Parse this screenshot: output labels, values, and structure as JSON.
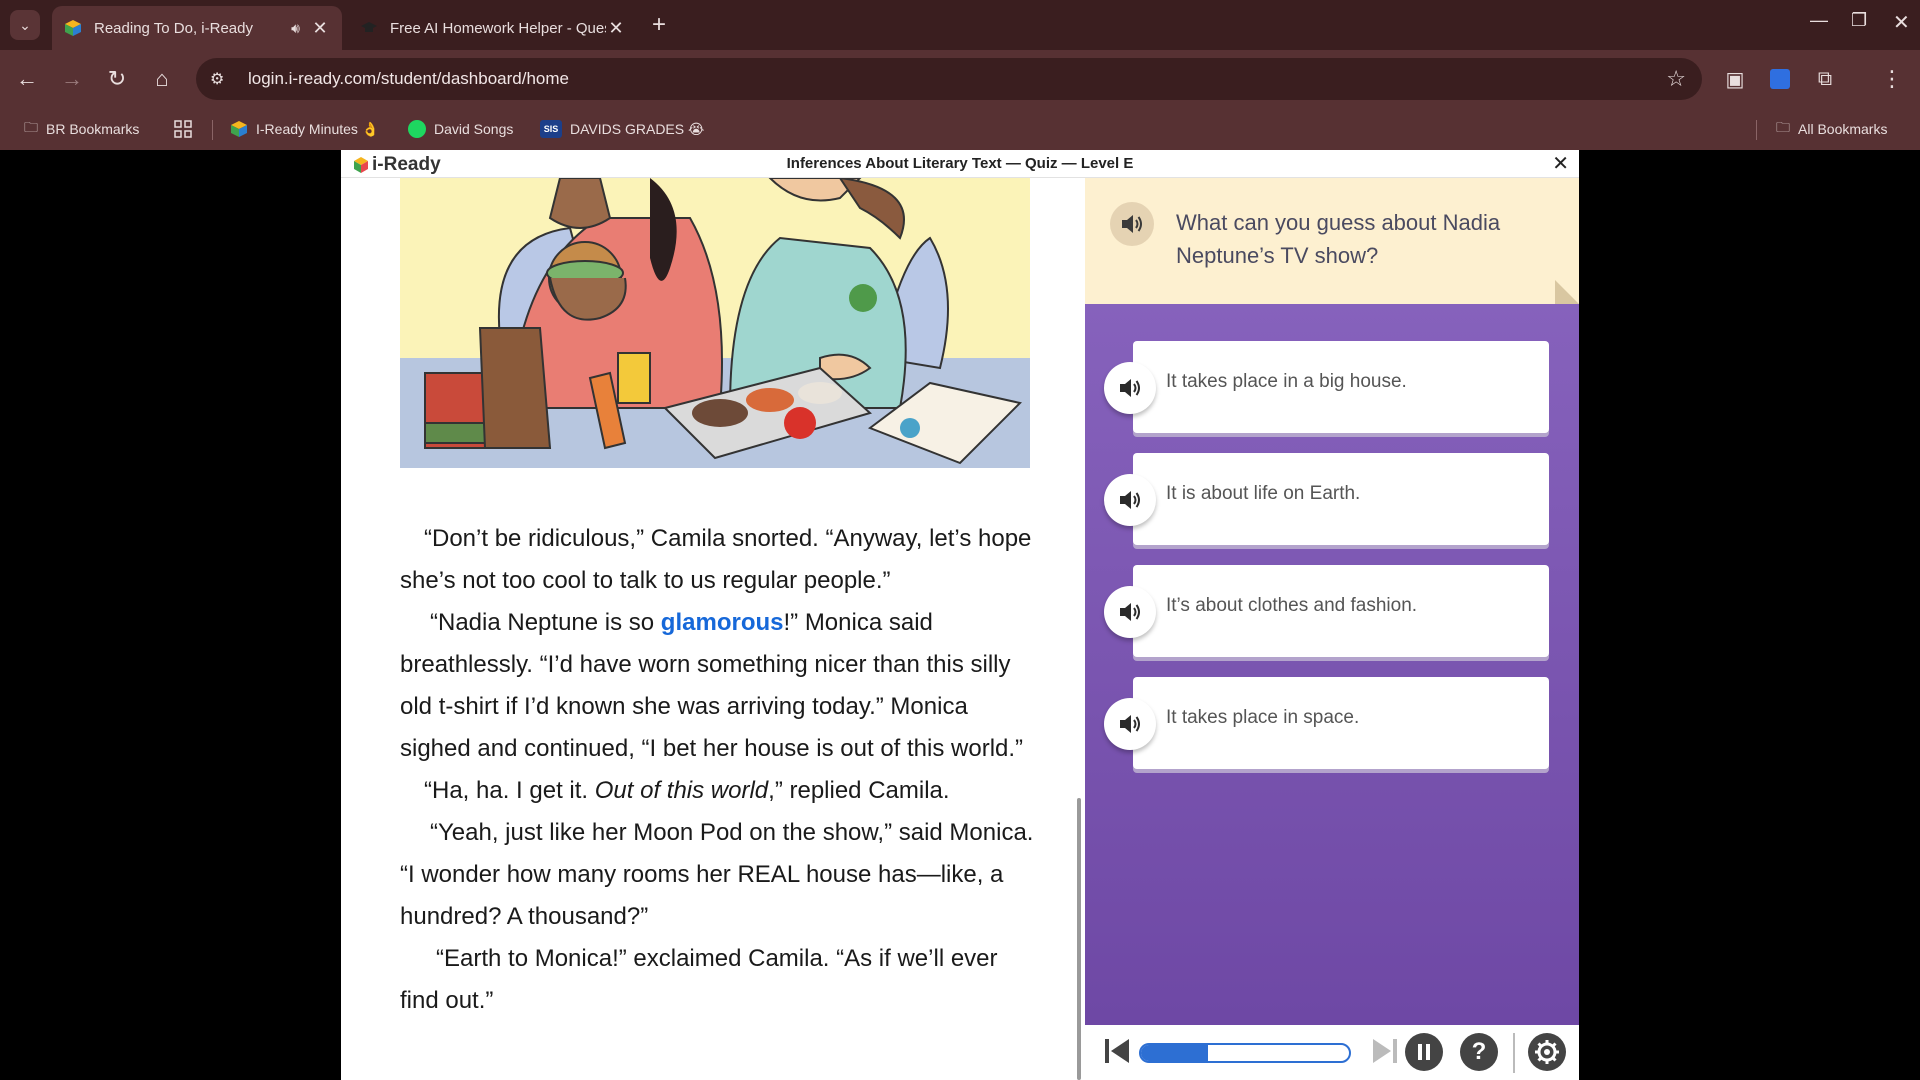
{
  "browser": {
    "tabs": [
      {
        "title": "Reading To Do, i-Ready",
        "active": true,
        "audio": true
      },
      {
        "title": "Free AI Homework Helper - Quest",
        "active": false,
        "audio": false
      }
    ],
    "url": "login.i-ready.com/student/dashboard/home",
    "bookmarks": [
      {
        "label": "BR Bookmarks"
      },
      {
        "label": "I-Ready Minutes 👌"
      },
      {
        "label": "David Songs"
      },
      {
        "label": "DAVIDS GRADES 😭"
      }
    ],
    "bookmark_sis_badge": "SIS",
    "all_bookmarks_label": "All Bookmarks"
  },
  "app": {
    "logo_text": "i-Ready",
    "quiz_title": "Inferences About Literary Text — Quiz — Level E",
    "passage": {
      "p1": "“Don’t be ridiculous,” Camila snorted. “Anyway, let’s hope she’s not too cool to talk to us regular people.”",
      "p2_before": "“Nadia Neptune is so ",
      "p2_vocab": "glamorous",
      "p2_after": "!” Monica said breathlessly. “I’d have worn something nicer than this silly old t-shirt if I’d known she was arriving today.” Monica sighed and continued, “I bet her house is out of this world.”",
      "p3_before": "“Ha, ha. I get it. ",
      "p3_italic": "Out of this world",
      "p3_after": ",” replied Camila.",
      "p4": "“Yeah, just like her Moon Pod on the show,” said Monica. “I wonder how many rooms her REAL house has—like, a hundred? A thousand?”",
      "p5": "“Earth to Monica!” exclaimed Camila. “As if we’ll ever find out.”"
    },
    "question": "What can you guess about Nadia Neptune’s TV show?",
    "answers": [
      "It takes place in a big house.",
      "It is about life on Earth.",
      "It’s about clothes and fashion.",
      "It takes place in space."
    ],
    "progress_percent": 32,
    "help_label": "?",
    "colors": {
      "accent": "#2d6fd3",
      "panel": "#7a55b0",
      "question_bg": "#fdf0d0",
      "vocab": "#1668d9"
    }
  }
}
